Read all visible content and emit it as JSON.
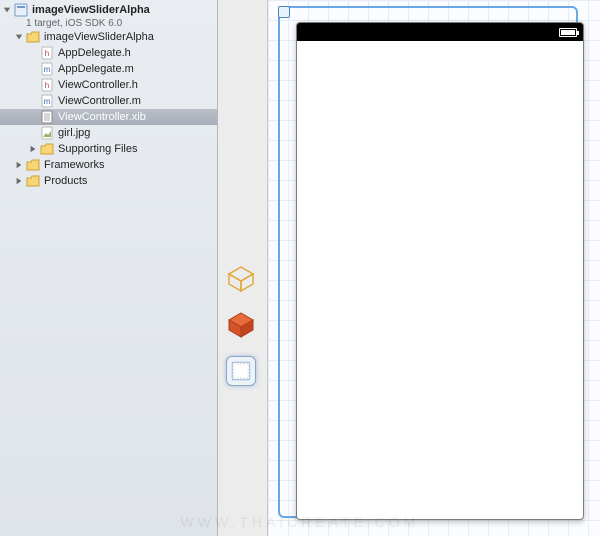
{
  "project": {
    "name": "imageViewSliderAlpha",
    "subtitle": "1 target, iOS SDK 6.0"
  },
  "tree": {
    "group1": "imageViewSliderAlpha",
    "files": {
      "appdelegate_h": "AppDelegate.h",
      "appdelegate_m": "AppDelegate.m",
      "viewcontroller_h": "ViewController.h",
      "viewcontroller_m": "ViewController.m",
      "viewcontroller_xib": "ViewController.xib",
      "girl_jpg": "girl.jpg"
    },
    "supporting_files": "Supporting Files",
    "frameworks": "Frameworks",
    "products": "Products"
  },
  "dock": {
    "files_owner": "files-owner",
    "first_responder": "first-responder",
    "view": "view"
  },
  "canvas": {
    "device": "iPhone portrait view"
  },
  "watermark": "WWW.THAICREATE.COM"
}
